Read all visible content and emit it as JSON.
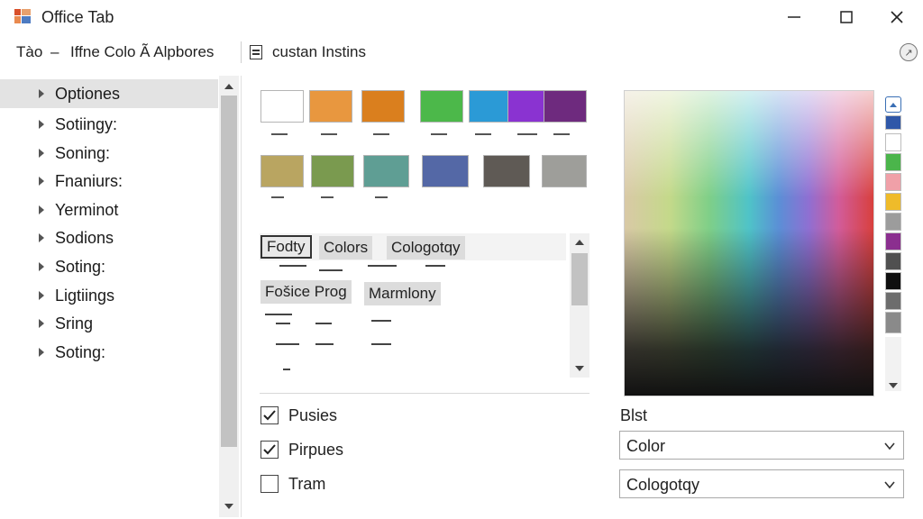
{
  "window": {
    "title": "Office Tab",
    "icon": "office-tab-app-icon",
    "controls": [
      "minimize-icon",
      "maximize-icon",
      "close-icon"
    ]
  },
  "toolbar": {
    "item1": "Tào",
    "dash": "–",
    "item2": "Iffne Colo Ã Alpbores",
    "item3": "custan Instins",
    "help_icon": "help-icon"
  },
  "sidebar": {
    "items": [
      {
        "label": "Optiones",
        "selected": true
      },
      {
        "label": "Sotiingy:"
      },
      {
        "label": "Soning:"
      },
      {
        "label": "Fnaniurs:"
      },
      {
        "label": "Yerminot"
      },
      {
        "label": "Sodions"
      },
      {
        "label": "Soting:"
      },
      {
        "label": "Ligtiings"
      },
      {
        "label": "Sring"
      },
      {
        "label": "Soting:"
      }
    ]
  },
  "swatches": {
    "row1": [
      "#ffffff",
      "#e8973f",
      "#da7f1e",
      "#4cb84a",
      "#2b9ad6",
      "#8a33d1",
      "#6e2a7e"
    ],
    "row2": [
      "#b9a561",
      "#7a9a4f",
      "#5f9e94",
      "#5468a6",
      "#5f5a55",
      "#9e9e9a"
    ]
  },
  "tags": {
    "row1": [
      "Fodty",
      "Colors",
      "Cologotqy"
    ],
    "row2": [
      "Fošice Prog",
      "Marmlony"
    ]
  },
  "checkboxes": [
    {
      "label": "Pusies",
      "checked": true
    },
    {
      "label": "Pirpues",
      "checked": true
    },
    {
      "label": "Tram",
      "checked": false
    }
  ],
  "palette": [
    "#2f57a8",
    "#ffffff",
    "#4bb54b",
    "#f0a0a8",
    "#efbb2a",
    "#9c9c9c",
    "#8b2f8f",
    "#505050",
    "#0f0f0f",
    "#6d6d6d",
    "#8a8a8a"
  ],
  "right_panel": {
    "label": "Blst",
    "select1": "Color",
    "select2": "Cologotqy"
  }
}
